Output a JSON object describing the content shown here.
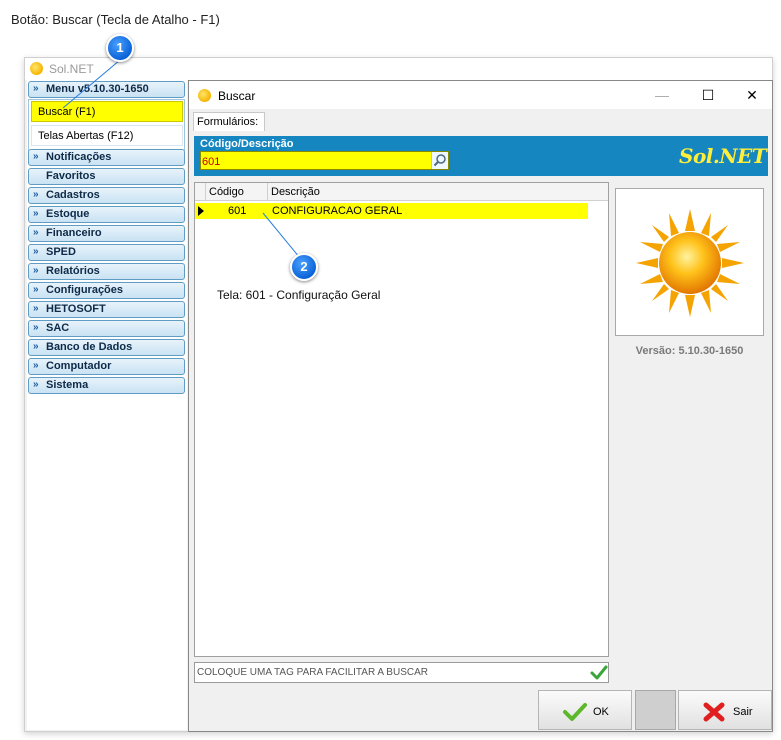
{
  "doc": {
    "title": "Botão: Buscar (Tecla de Atalho - F1)",
    "annotation": "Tela: 601 - Configuração Geral"
  },
  "callouts": [
    "1",
    "2"
  ],
  "app": {
    "title": "Sol.NET",
    "icon": "sun-icon"
  },
  "sidebar": {
    "open_group": "Menu v5.10.30-1650",
    "open_items": [
      "Buscar (F1)",
      "Telas Abertas (F12)"
    ],
    "groups": [
      "Notificações",
      "Favoritos",
      "Cadastros",
      "Estoque",
      "Financeiro",
      "SPED",
      "Relatórios",
      "Configurações",
      "HETOSOFT",
      "SAC",
      "Banco de Dados",
      "Computador",
      "Sistema"
    ]
  },
  "dialog": {
    "title": "Buscar",
    "tab": "Formulários:",
    "search_label": "Código/Descrição",
    "search_value": "601",
    "brand": "Sol.NET",
    "grid": {
      "headers": [
        "Código",
        "Descrição"
      ],
      "rows": [
        {
          "code": "601",
          "description": "CONFIGURACAO GERAL"
        }
      ]
    },
    "version": "Versão: 5.10.30-1650",
    "tag_placeholder": "COLOQUE UMA TAG PARA FACILITAR A BUSCAR",
    "ok_label": "OK",
    "exit_label": "Sair"
  },
  "colors": {
    "highlight": "#ffff00",
    "band": "#1586c0",
    "callout": "#0b63d8"
  }
}
